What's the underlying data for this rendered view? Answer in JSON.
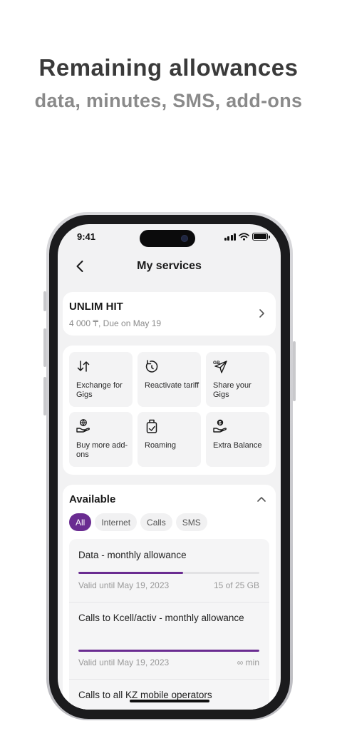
{
  "promo": {
    "title": "Remaining allowances",
    "subtitle": "data, minutes, SMS, add-ons"
  },
  "status_bar": {
    "time": "9:41"
  },
  "header": {
    "title": "My services"
  },
  "tariff": {
    "name": "UNLIM HIT",
    "info": "4 000 ₸, Due on May 19"
  },
  "actions": [
    {
      "label": "Exchange for Gigs",
      "icon": "exchange-arrows-icon"
    },
    {
      "label": "Reactivate tariff",
      "icon": "reactivate-icon"
    },
    {
      "label": "Share your Gigs",
      "icon": "share-gigs-icon"
    },
    {
      "label": "Buy more add-ons",
      "icon": "globe-hand-icon"
    },
    {
      "label": "Roaming",
      "icon": "luggage-icon"
    },
    {
      "label": "Extra Balance",
      "icon": "coin-hand-icon"
    }
  ],
  "available": {
    "title": "Available",
    "filters": [
      {
        "label": "All",
        "active": true
      },
      {
        "label": "Internet",
        "active": false
      },
      {
        "label": "Calls",
        "active": false
      },
      {
        "label": "SMS",
        "active": false
      }
    ],
    "items": [
      {
        "name": "Data - monthly allowance",
        "valid": "Valid until May 19, 2023",
        "amount": "15 of 25 GB",
        "progress": 0.58
      },
      {
        "name": "Calls to Kcell/activ - monthly allowance",
        "valid": "Valid until May 19, 2023",
        "amount": "∞ min",
        "progress": 1.0
      },
      {
        "name": "Calls to all KZ mobile operators",
        "valid": "",
        "amount": "",
        "progress": null
      }
    ]
  },
  "colors": {
    "accent": "#6a2c91",
    "title": "#3a3a3a",
    "subtitle": "#8a8a8a"
  }
}
